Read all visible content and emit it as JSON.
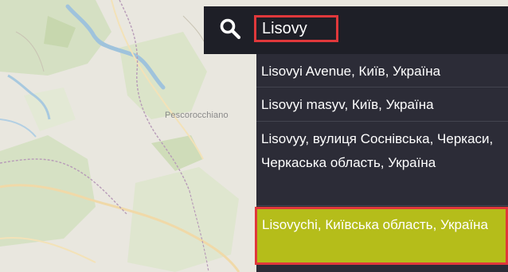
{
  "map": {
    "place_label": "Pescorocchiano"
  },
  "search": {
    "value": "Lisovy",
    "icon": "search-icon"
  },
  "results": [
    {
      "label": "Lisovyi Avenue, Київ, Україна"
    },
    {
      "label": "Lisovyi masyv, Київ, Україна"
    },
    {
      "label": "Lisovyy, вулиця Соснівська, Черкаси, Черкаська область, Україна"
    },
    {
      "label": "Lisovychi, Київська область, Україна"
    }
  ],
  "colors": {
    "search_bar": "#1e1f27",
    "dropdown": "#2c2c37",
    "highlight": "#b5bd1a",
    "annotation_border": "#e0383b"
  }
}
